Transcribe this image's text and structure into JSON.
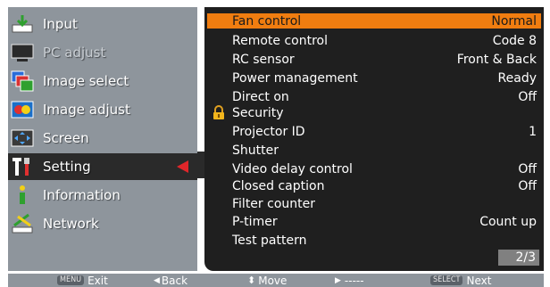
{
  "sidebar": {
    "items": [
      {
        "label": "Input",
        "icon": "input-icon"
      },
      {
        "label": "PC adjust",
        "icon": "monitor-icon",
        "disabled": true
      },
      {
        "label": "Image select",
        "icon": "image-select-icon"
      },
      {
        "label": "Image adjust",
        "icon": "image-adjust-icon"
      },
      {
        "label": "Screen",
        "icon": "screen-icon"
      },
      {
        "label": "Setting",
        "icon": "setting-icon",
        "selected": true
      },
      {
        "label": "Information",
        "icon": "information-icon"
      },
      {
        "label": "Network",
        "icon": "network-icon"
      }
    ]
  },
  "menu": {
    "rows": [
      {
        "label": "Fan control",
        "value": "Normal"
      },
      {
        "label": "Remote control",
        "value": "Code 8"
      },
      {
        "label": "RC sensor",
        "value": "Front & Back"
      },
      {
        "label": "Power management",
        "value": "Ready"
      },
      {
        "label": "Direct on",
        "value": "Off"
      },
      {
        "label": "Security",
        "value": "",
        "icon": "lock-icon"
      },
      {
        "label": "Projector ID",
        "value": "1"
      },
      {
        "label": "Shutter",
        "value": ""
      },
      {
        "label": "Video delay control",
        "value": "Off"
      },
      {
        "label": "Closed caption",
        "value": "Off"
      },
      {
        "label": "Filter counter",
        "value": ""
      },
      {
        "label": "P-timer",
        "value": "Count up"
      },
      {
        "label": "Test pattern",
        "value": ""
      }
    ],
    "page": "2/3"
  },
  "bottombar": {
    "menu_tag": "MENU",
    "exit": "Exit",
    "back": "Back",
    "move": "Move",
    "right_action": "-----",
    "select_tag": "SELECT",
    "next": "Next"
  },
  "colors": {
    "sidebar_bg": "#8e959c",
    "main_bg": "#1f1f1f",
    "selected_row": "#f07d10",
    "pointer": "#e0262a"
  }
}
